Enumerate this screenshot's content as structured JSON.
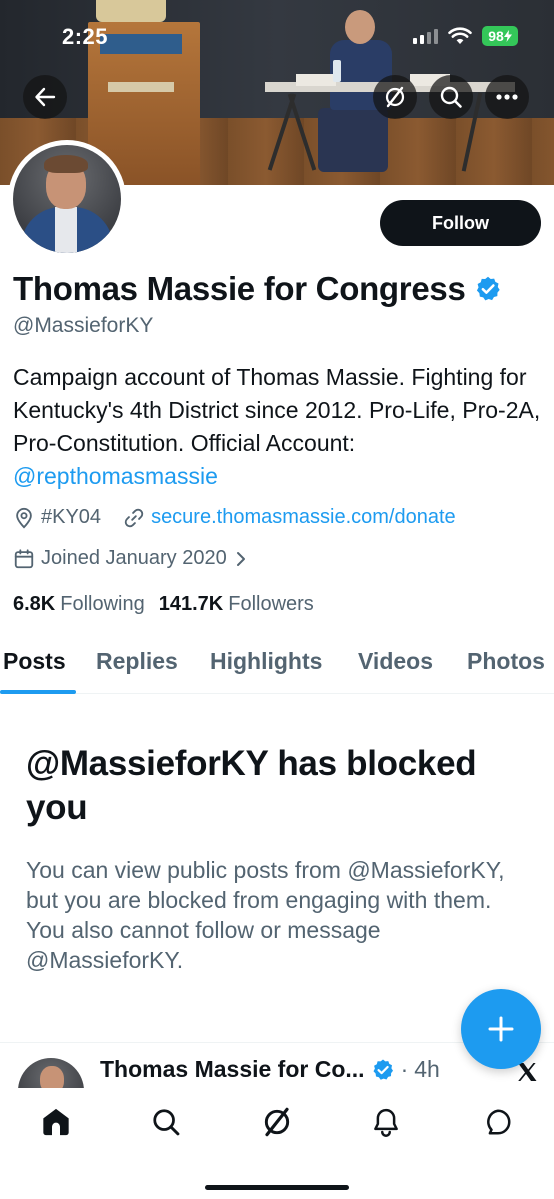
{
  "status_bar": {
    "time": "2:25",
    "battery": "98"
  },
  "header": {
    "back_icon": "arrow-left-icon",
    "grok_icon": "grok-slash-icon",
    "search_icon": "search-icon",
    "more_icon": "more-dots-icon"
  },
  "profile": {
    "follow_label": "Follow",
    "display_name": "Thomas Massie for Congress",
    "handle": "@MassieforKY",
    "bio_text": "Campaign account of Thomas Massie. Fighting for Kentucky's 4th District since 2012. Pro-Life, Pro-2A, Pro-Constitution. Official Account: ",
    "bio_mention": "@repthomasmassie",
    "location": "#KY04",
    "website": "secure.thomasmassie.com/donate",
    "joined": "Joined January 2020",
    "following_count": "6.8K",
    "following_label": "Following",
    "followers_count": "141.7K",
    "followers_label": "Followers"
  },
  "tabs": [
    {
      "label": "Posts"
    },
    {
      "label": "Replies"
    },
    {
      "label": "Highlights"
    },
    {
      "label": "Videos"
    },
    {
      "label": "Photos"
    }
  ],
  "blocked": {
    "title": "@MassieforKY has blocked you",
    "description": "You can view public posts from @MassieforKY, but you are blocked from engaging with them. You also cannot follow or message @MassieforKY."
  },
  "tweet_preview": {
    "name": "Thomas Massie for Co...",
    "time": "4h"
  },
  "colors": {
    "accent": "#1d9bf0",
    "text_primary": "#0f1419",
    "text_secondary": "#536471",
    "battery": "#34c759"
  }
}
